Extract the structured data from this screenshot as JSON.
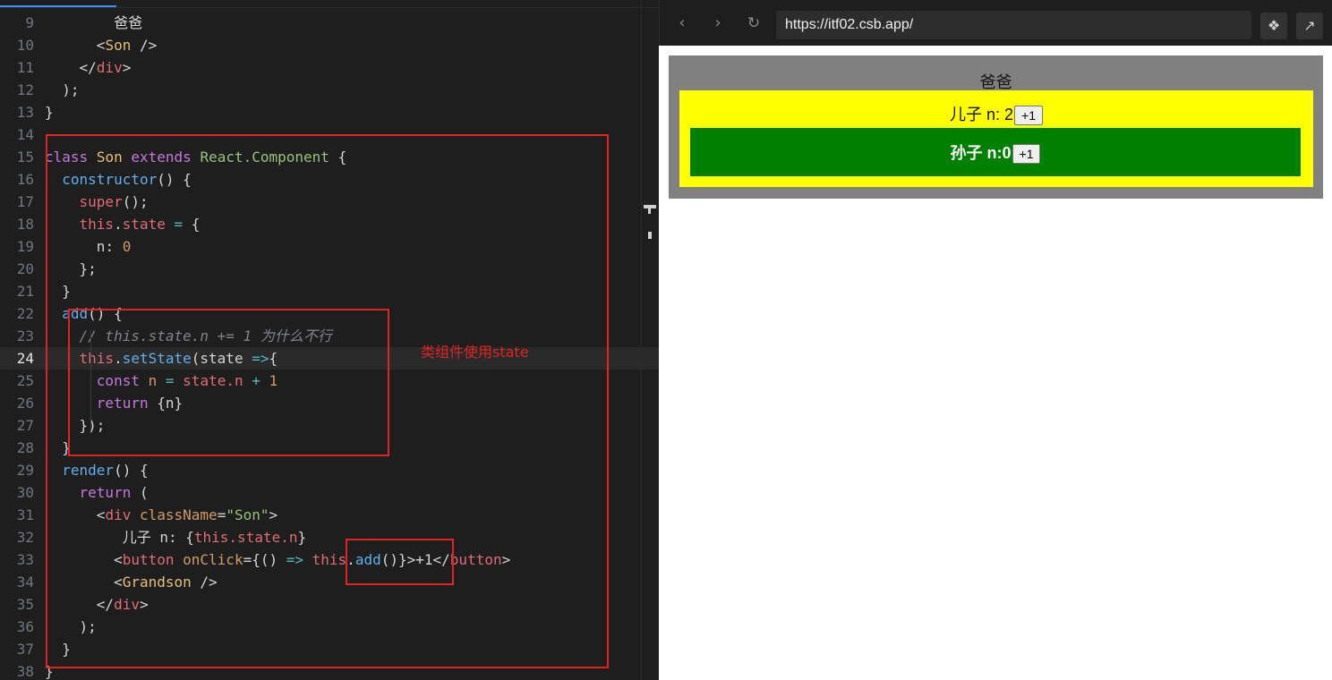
{
  "editor": {
    "lines": [
      {
        "n": "9"
      },
      {
        "n": "10"
      },
      {
        "n": "11"
      },
      {
        "n": "12"
      },
      {
        "n": "13"
      },
      {
        "n": "14"
      },
      {
        "n": "15"
      },
      {
        "n": "16"
      },
      {
        "n": "17"
      },
      {
        "n": "18"
      },
      {
        "n": "19"
      },
      {
        "n": "20"
      },
      {
        "n": "21"
      },
      {
        "n": "22"
      },
      {
        "n": "23"
      },
      {
        "n": "24"
      },
      {
        "n": "25"
      },
      {
        "n": "26"
      },
      {
        "n": "27"
      },
      {
        "n": "28"
      },
      {
        "n": "29"
      },
      {
        "n": "30"
      },
      {
        "n": "31"
      },
      {
        "n": "32"
      },
      {
        "n": "33"
      },
      {
        "n": "34"
      },
      {
        "n": "35"
      },
      {
        "n": "36"
      },
      {
        "n": "37"
      },
      {
        "n": "38"
      }
    ],
    "code": {
      "l9_text": "爸爸",
      "l10_tag": "Son",
      "l11_tag": "div",
      "l15_class": "class",
      "l15_name": "Son",
      "l15_extends": "extends",
      "l15_parent": "React.Component",
      "l16_fn": "constructor",
      "l17_super": "super",
      "l18_this": "this",
      "l18_prop": "state",
      "l19_key": "n",
      "l19_val": "0",
      "l22_fn": "add",
      "l23_comment": "// this.state.n += 1 为什么不行",
      "l24_this": "this",
      "l24_fn": "setState",
      "l24_param": "state",
      "l25_const": "const",
      "l25_var": "n",
      "l25_expr": "state.n",
      "l25_num": "1",
      "l26_return": "return",
      "l26_val": "{n}",
      "l29_fn": "render",
      "l30_return": "return",
      "l31_tag": "div",
      "l31_attr": "className",
      "l31_str": "\"Son\"",
      "l32_text": "儿子 n: ",
      "l32_expr": "this.state.n",
      "l33_tag": "button",
      "l33_attr": "onClick",
      "l33_this": "this",
      "l33_fn": "add",
      "l33_label": "+1",
      "l34_tag": "Grandson",
      "l35_tag": "div"
    },
    "annotation": "类组件使用state",
    "current_line": "24"
  },
  "browser": {
    "url": "https://itf02.csb.app/",
    "icons": {
      "back": "chevron-left-icon",
      "forward": "chevron-right-icon",
      "refresh": "refresh-icon",
      "devtools": "codesandbox-icon",
      "open": "open-external-icon"
    },
    "dad": {
      "title": "爸爸"
    },
    "son": {
      "label": "儿子 n: 2",
      "button": "+1"
    },
    "grandson": {
      "label": "孙子 n:0",
      "button": "+1"
    }
  },
  "colors": {
    "highlight_box": "#e02424",
    "dad_bg": "#808080",
    "son_bg": "#ffff00",
    "grandson_bg": "#008000"
  }
}
